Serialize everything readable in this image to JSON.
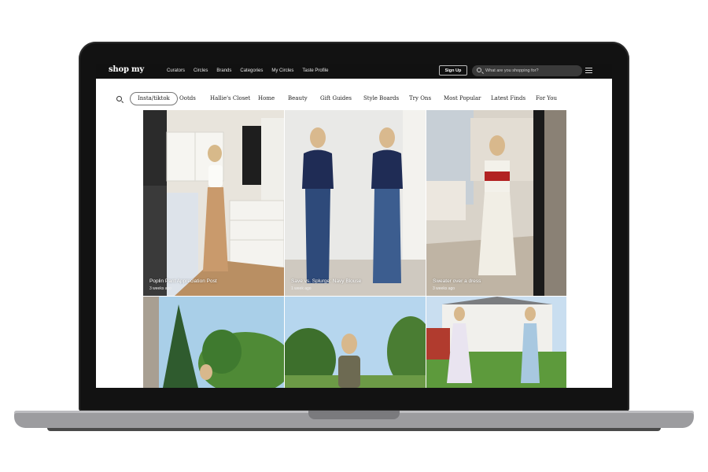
{
  "brand": {
    "logo": "shop my"
  },
  "nav": {
    "links": [
      "Curators",
      "Circles",
      "Brands",
      "Categories",
      "My Circles",
      "Taste Profile"
    ]
  },
  "header": {
    "signup_label": "Sign Up",
    "search_placeholder": "What are you shopping for?"
  },
  "filters": {
    "active": "Insta/tiktok",
    "items": [
      "Insta/tiktok",
      "Ootds",
      "Hallie's Closet",
      "Home",
      "Beauty",
      "Gift Guides",
      "Style Boards",
      "Try Ons",
      "Most Popular",
      "Latest Finds",
      "For You"
    ]
  },
  "posts": [
    {
      "title": "Poplin Pant Appreciation Post",
      "time": "3 weeks ago"
    },
    {
      "title": "Save vs. Splurge: Navy Blouse",
      "time": "1 week ago"
    },
    {
      "title": "Sweater over a dress",
      "time": "3 weeks ago"
    }
  ],
  "colors": {
    "topbar": "#111111",
    "screen_bg": "#ffffff",
    "laptop_body": "#121212",
    "laptop_base": "#9c9c9f"
  }
}
